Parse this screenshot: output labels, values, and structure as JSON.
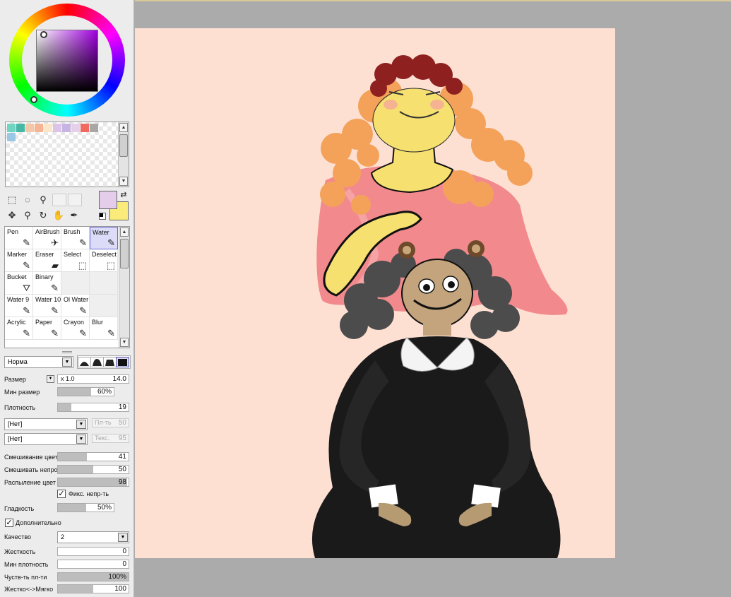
{
  "color_panel": {
    "ring_colors": [
      "#ff0000",
      "#ff00ff",
      "#0000ff",
      "#00ffff",
      "#00ff00",
      "#ffff00"
    ],
    "hue_color": "#a000e0"
  },
  "swatches": [
    "#6fd5c0",
    "#46b8a6",
    "#f4c7a7",
    "#f7b495",
    "#fbe6c9",
    "#dcc4e8",
    "#c7b4e4",
    "#e5cfe9",
    "#f06a62",
    "#aaa6a3",
    "#9ac8e4"
  ],
  "colors": {
    "foreground": "#e3cdea",
    "background": "#fbeb7a"
  },
  "select_icons": [
    "rect-select-icon",
    "lasso-icon",
    "magic-wand-icon",
    "move-icon",
    "zoom-icon",
    "rotate-icon",
    "hand-icon",
    "eyedropper-icon"
  ],
  "tools": [
    {
      "label": "Pen",
      "icon": "✎"
    },
    {
      "label": "AirBrush",
      "icon": "✈"
    },
    {
      "label": "Brush",
      "icon": "✎"
    },
    {
      "label": "Water",
      "icon": "✎"
    },
    {
      "label": "Marker",
      "icon": "✎"
    },
    {
      "label": "Eraser",
      "icon": "▰"
    },
    {
      "label": "Select",
      "icon": "⬚"
    },
    {
      "label": "Deselect",
      "icon": "⬚"
    },
    {
      "label": "Bucket",
      "icon": "⛛"
    },
    {
      "label": "Binary",
      "icon": "✎"
    },
    {
      "label": "",
      "icon": ""
    },
    {
      "label": "",
      "icon": ""
    },
    {
      "label": "Water 9",
      "icon": "✎"
    },
    {
      "label": "Water 10",
      "icon": "✎"
    },
    {
      "label": "Ol Water",
      "icon": "✎"
    },
    {
      "label": "",
      "icon": ""
    },
    {
      "label": "Acrylic",
      "icon": "✎"
    },
    {
      "label": "Paper",
      "icon": "✎"
    },
    {
      "label": "Crayon",
      "icon": "✎"
    },
    {
      "label": "Blur",
      "icon": "✎"
    }
  ],
  "brush": {
    "blend_mode": "Норма",
    "size_label": "Размер",
    "size_multiplier": "x 1.0",
    "size_value": "14.0",
    "min_size_label": "Мин размер",
    "min_size_value": "60%",
    "min_size_level": 0.6,
    "density_label": "Плотность",
    "density_value": "19",
    "density_level": 0.19,
    "paper_select": "[Нет]",
    "paper_strength_label": "Пл-ть",
    "paper_strength_value": "50",
    "texture_select": "[Нет]",
    "texture_label": "Текс.",
    "texture_value": "95",
    "blending_label": "Смешивание цвет",
    "blending_value": "41",
    "blending_level": 0.41,
    "dilution_label": "Смешивать непро",
    "dilution_value": "50",
    "dilution_level": 0.5,
    "persistence_label": "Распыление цвет",
    "persistence_value": "98",
    "persistence_level": 0.98,
    "keep_opacity_label": "Фикс. непр-ть",
    "smoothing_label": "Гладкость",
    "smoothing_value": "50%",
    "smoothing_level": 0.5,
    "advanced_label": "Дополнительно",
    "quality_label": "Качество",
    "quality_value": "2",
    "hardness_label": "Жесткость",
    "hardness_value": "0",
    "hardness_level": 0,
    "min_density_label": "Мин плотность",
    "min_density_value": "0",
    "min_density_level": 0,
    "max_density_pressure_label": "Чуств-ть пл-ти",
    "max_density_pressure_value": "100%",
    "max_density_pressure_level": 1.0,
    "hard_soft_label": "Жестко<->Мягко",
    "hard_soft_value": "100",
    "hard_soft_level": 0.5
  },
  "canvas": {
    "paper_color": "#fee0d3"
  }
}
